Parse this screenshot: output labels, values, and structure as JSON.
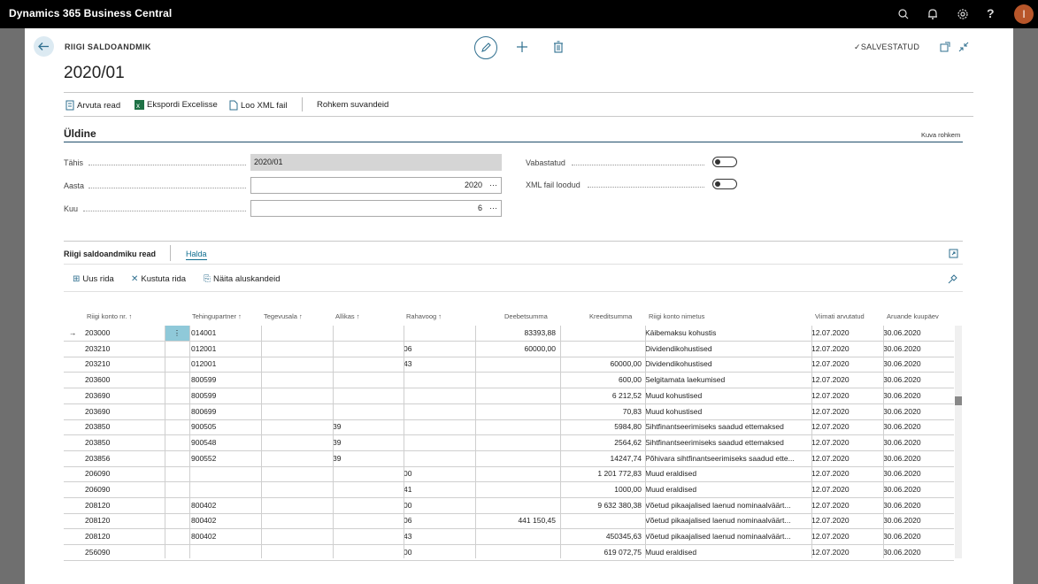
{
  "app": {
    "title": "Dynamics 365 Business Central",
    "user_initial": "I"
  },
  "topbar_icons": [
    "search-icon",
    "bell-icon",
    "gear-icon",
    "help-icon"
  ],
  "header": {
    "breadcrumb": "RIIGI SALDOANDMIK",
    "title": "2020/01",
    "saved_label": "SALVESTATUD"
  },
  "actions": {
    "compute": "Arvuta read",
    "export": "Ekspordi Excelisse",
    "xml": "Loo XML fail",
    "more": "Rohkem suvandeid"
  },
  "general": {
    "title": "Üldine",
    "show_more": "Kuva rohkem",
    "tahis_label": "Tähis",
    "tahis_value": "2020/01",
    "aasta_label": "Aasta",
    "aasta_value": "2020",
    "kuu_label": "Kuu",
    "kuu_value": "6",
    "vabastatud_label": "Vabastatud",
    "xml_label": "XML fail loodud"
  },
  "lines": {
    "title": "Riigi saldoandmiku read",
    "tab": "Halda",
    "new_row": "Uus rida",
    "delete_row": "Kustuta rida",
    "show_docs": "Näita aluskandeid",
    "columns": [
      "Riigi konto nr. ↑",
      "Tehingupartner ↑",
      "Tegevusala ↑",
      "Allikas ↑",
      "Rahavoog ↑",
      "Deebetsumma",
      "Kreeditsumma",
      "Riigi konto nimetus",
      "Viimati arvutatud",
      "Aruande kuupäev"
    ],
    "rows": [
      [
        "203000",
        "014001",
        "",
        "",
        "",
        "83393,88",
        "",
        "Käibemaksu kohustis",
        "12.07.2020",
        "30.06.2020"
      ],
      [
        "203210",
        "012001",
        "",
        "",
        "06",
        "60000,00",
        "",
        "Dividendikohustised",
        "12.07.2020",
        "30.06.2020"
      ],
      [
        "203210",
        "012001",
        "",
        "",
        "43",
        "",
        "60000,00",
        "Dividendikohustised",
        "12.07.2020",
        "30.06.2020"
      ],
      [
        "203600",
        "800599",
        "",
        "",
        "",
        "",
        "600,00",
        "Selgitamata laekumised",
        "12.07.2020",
        "30.06.2020"
      ],
      [
        "203690",
        "800599",
        "",
        "",
        "",
        "",
        "6 212,52",
        "Muud kohustised",
        "12.07.2020",
        "30.06.2020"
      ],
      [
        "203690",
        "800699",
        "",
        "",
        "",
        "",
        "70,83",
        "Muud kohustised",
        "12.07.2020",
        "30.06.2020"
      ],
      [
        "203850",
        "900505",
        "",
        "39",
        "",
        "",
        "5984,80",
        "Sihtfinantseerimiseks saadud ettemaksed",
        "12.07.2020",
        "30.06.2020"
      ],
      [
        "203850",
        "900548",
        "",
        "39",
        "",
        "",
        "2564,62",
        "Sihtfinantseerimiseks saadud ettemaksed",
        "12.07.2020",
        "30.06.2020"
      ],
      [
        "203856",
        "900552",
        "",
        "39",
        "",
        "",
        "14247,74",
        "Põhivara sihtfinantseerimiseks saadud ette...",
        "12.07.2020",
        "30.06.2020"
      ],
      [
        "206090",
        "",
        "",
        "",
        "00",
        "",
        "1 201 772,83",
        "Muud eraldised",
        "12.07.2020",
        "30.06.2020"
      ],
      [
        "206090",
        "",
        "",
        "",
        "41",
        "",
        "1000,00",
        "Muud eraldised",
        "12.07.2020",
        "30.06.2020"
      ],
      [
        "208120",
        "800402",
        "",
        "",
        "00",
        "",
        "9 632 380,38",
        "Võetud pikaajalised laenud nominaalväärt...",
        "12.07.2020",
        "30.06.2020"
      ],
      [
        "208120",
        "800402",
        "",
        "",
        "06",
        "441 150,45",
        "",
        "Võetud pikaajalised laenud nominaalväärt...",
        "12.07.2020",
        "30.06.2020"
      ],
      [
        "208120",
        "800402",
        "",
        "",
        "43",
        "",
        "450345,63",
        "Võetud pikaajalised laenud nominaalväärt...",
        "12.07.2020",
        "30.06.2020"
      ],
      [
        "256090",
        "",
        "",
        "",
        "00",
        "",
        "619 072,75",
        "Muud eraldised",
        "12.07.2020",
        "30.06.2020"
      ]
    ]
  }
}
